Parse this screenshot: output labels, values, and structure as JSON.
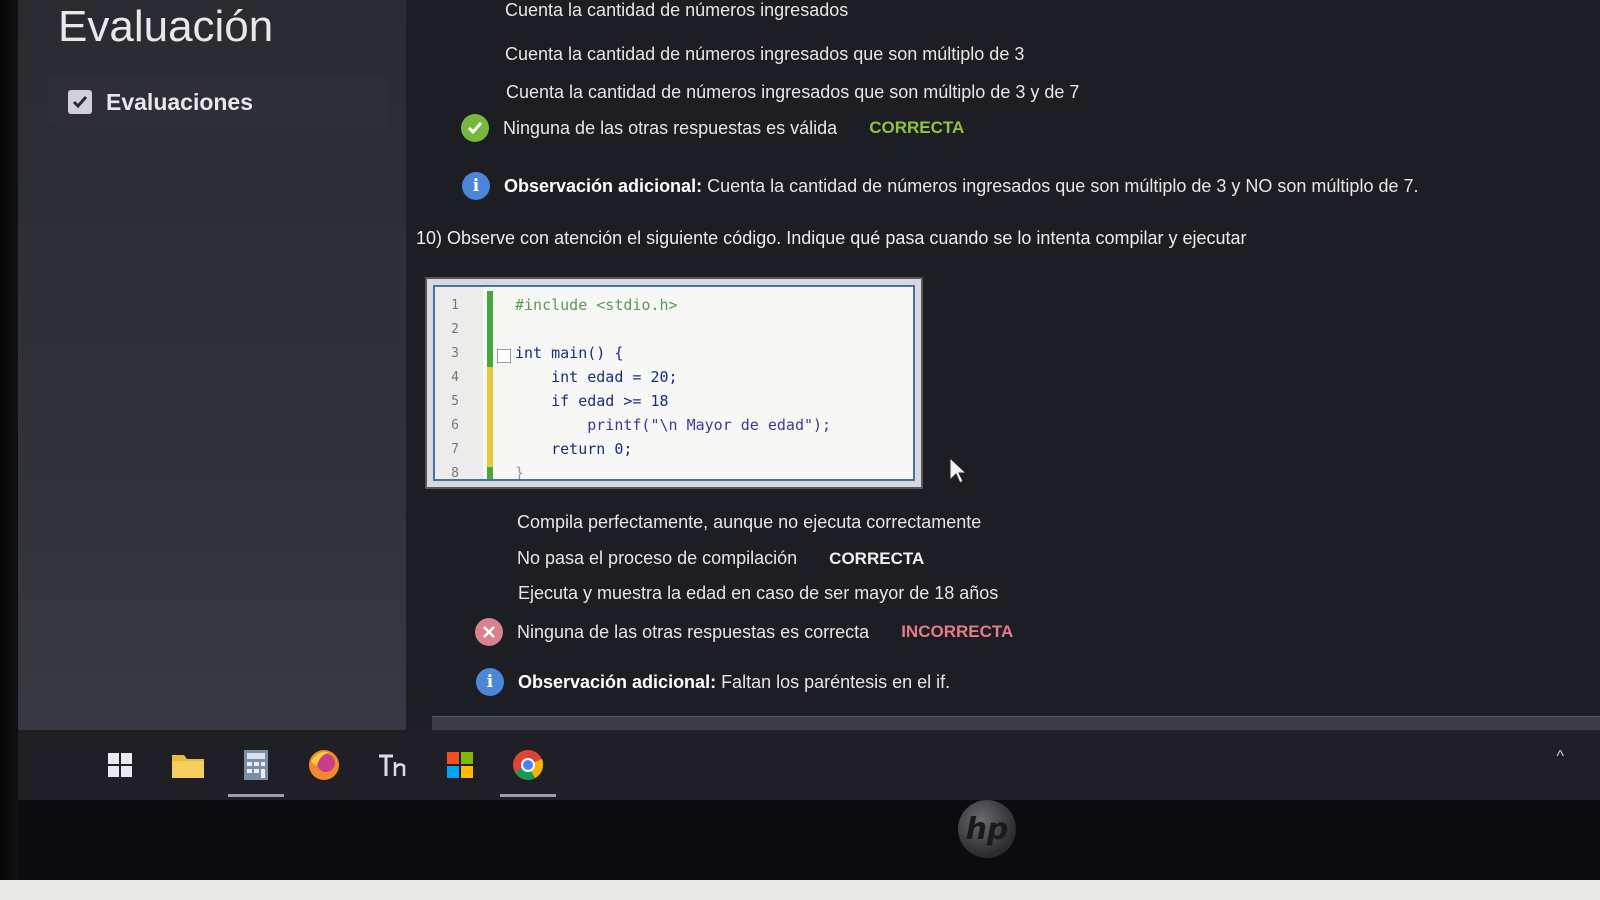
{
  "app": {
    "title": "Evaluación"
  },
  "sidebar": {
    "items": [
      {
        "label": "Evaluaciones",
        "checked": true
      }
    ]
  },
  "q9": {
    "options": [
      {
        "text": "Cuenta la cantidad de números ingresados"
      },
      {
        "text": "Cuenta la cantidad de números ingresados que son múltiplo de 3"
      },
      {
        "text": "Cuenta la cantidad de números ingresados que son múltiplo de 3 y de 7"
      },
      {
        "text": "Ninguna de las otras respuestas es válida",
        "badge": "CORRECTA",
        "icon": "check-icon"
      }
    ],
    "observation": {
      "label": "Observación adicional:",
      "text": " Cuenta la cantidad de números ingresados que son múltiplo de 3 y NO son múltiplo de 7."
    }
  },
  "q10": {
    "question": "10) Observe con atención el siguiente código. Indique qué pasa cuando se lo intenta compilar y ejecutar",
    "code": [
      {
        "n": "1",
        "text": "#include <stdio.h>"
      },
      {
        "n": "2",
        "text": ""
      },
      {
        "n": "3",
        "text": "int main() {"
      },
      {
        "n": "4",
        "text": "    int edad = 20;"
      },
      {
        "n": "5",
        "text": "    if edad >= 18"
      },
      {
        "n": "6",
        "text": "        printf(\"\\n Mayor de edad\");"
      },
      {
        "n": "7",
        "text": "    return 0;"
      },
      {
        "n": "8",
        "text": "}"
      }
    ],
    "options": [
      {
        "text": "Compila perfectamente, aunque no ejecuta correctamente"
      },
      {
        "text": "No pasa el proceso de compilación",
        "badge": "CORRECTA"
      },
      {
        "text": "Ejecuta y muestra la edad en caso de ser mayor de 18 años"
      },
      {
        "text": "Ninguna de las otras respuestas es correcta",
        "badge": "INCORRECTA",
        "icon": "x-icon"
      }
    ],
    "observation": {
      "label": "Observación adicional:",
      "text": " Faltan los paréntesis en el if."
    }
  },
  "taskbar": {
    "icons": [
      "windows-start-icon",
      "file-explorer-icon",
      "calculator-icon",
      "firefox-icon",
      "text-editor-icon",
      "store-icon",
      "chrome-icon"
    ]
  },
  "monitor": {
    "brand": "hp"
  },
  "colors": {
    "correct": "#8ec43e",
    "incorrect": "#e57a8a",
    "info": "#4c86d6",
    "background": "#1d1e24"
  }
}
